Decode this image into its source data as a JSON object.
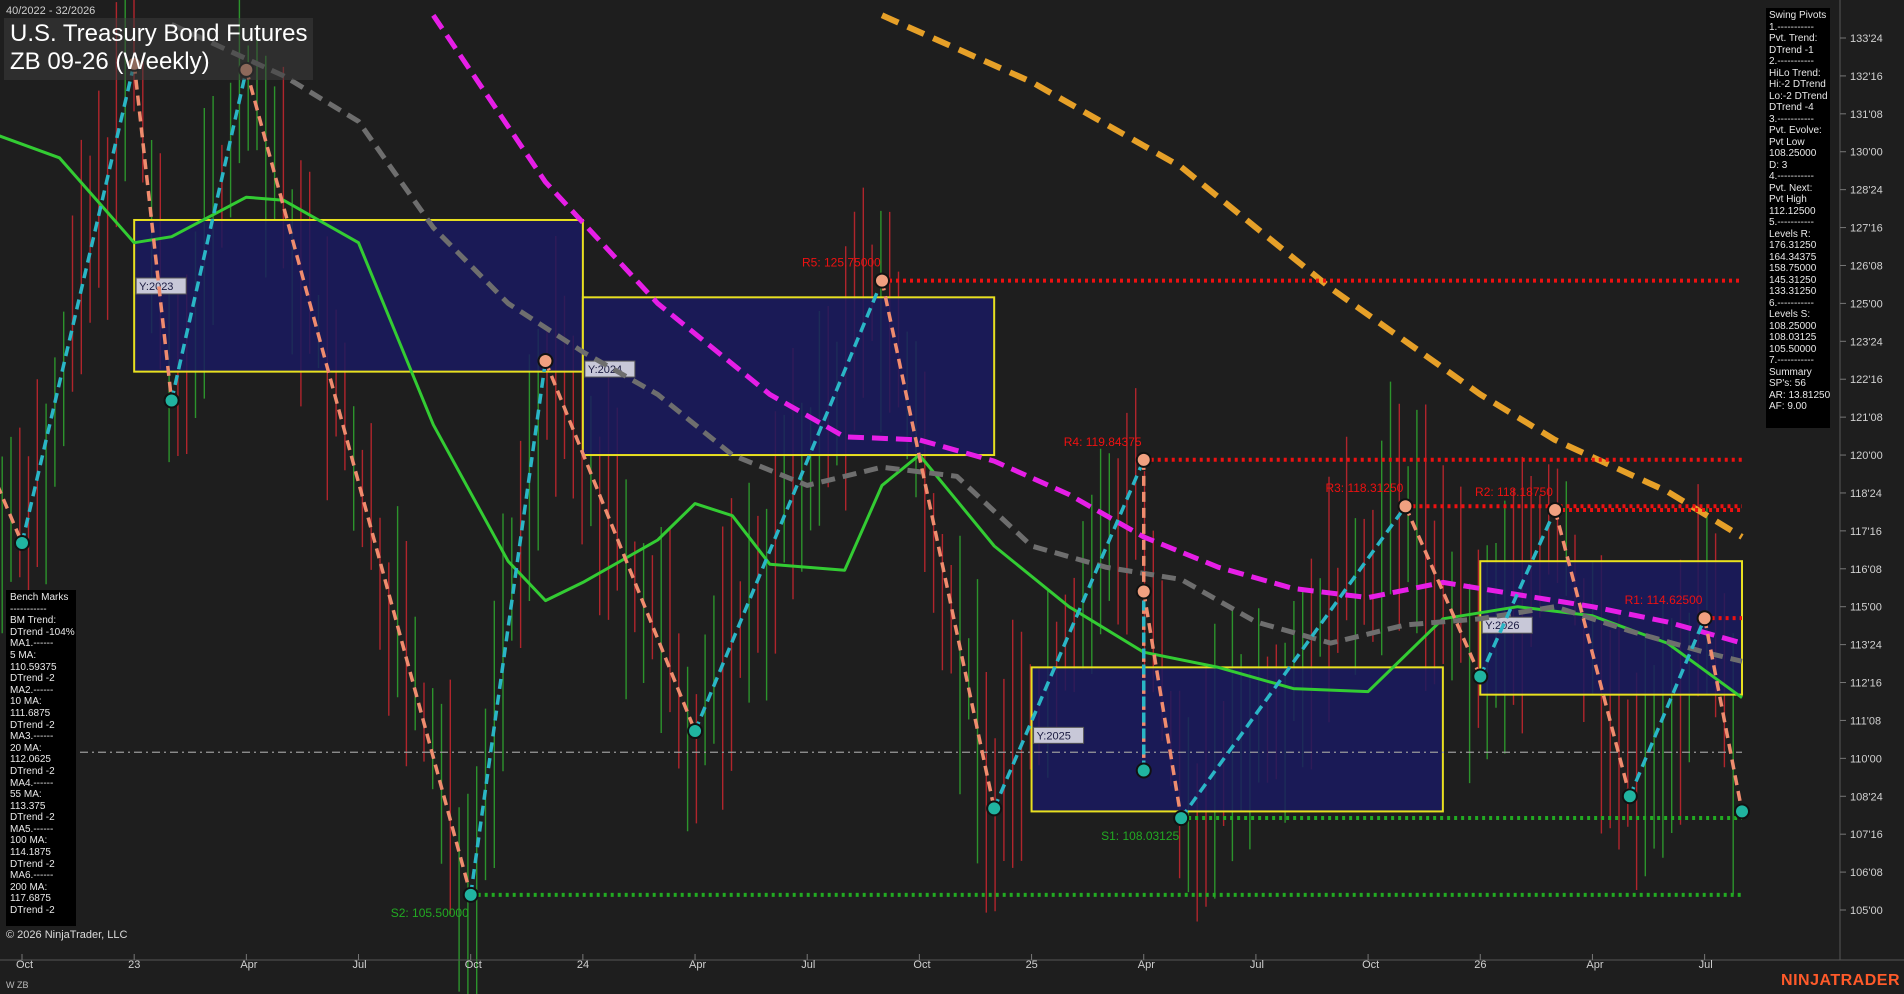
{
  "header": {
    "date_range": "40/2022 - 32/2026",
    "title_line1": "U.S. Treasury Bond Futures",
    "title_line2": "ZB 09-26 (Weekly)"
  },
  "footer": {
    "copyright": "© 2026 NinjaTrader, LLC",
    "brand": "NINJATRADER",
    "symbol_tag": "W ZB"
  },
  "colors": {
    "background": "#1e1e1e",
    "up_bar": "#2ea02e",
    "down_bar": "#c0262e",
    "ma_green": "#33cc33",
    "ma_gray": "#6e6e6e",
    "ma_magenta": "#e61ee6",
    "ma_orange": "#e6a028",
    "swing_up": "#2ab6c6",
    "swing_down": "#f08c6e",
    "zone_fill": "#1a1a60",
    "zone_border": "#e8e020",
    "resistance": "#ee1111",
    "support": "#22aa22"
  },
  "benchmarks": {
    "lines": [
      "Bench Marks",
      "-----------",
      "BM Trend:",
      "DTrend -104%",
      "MA1.------",
      "5 MA:",
      "110.59375",
      "DTrend -2",
      "MA2.------",
      "10 MA:",
      "111.6875",
      "DTrend -2",
      "MA3.------",
      "20 MA:",
      "112.0625",
      "DTrend -2",
      "MA4.------",
      "55 MA:",
      "113.375",
      "DTrend -2",
      "MA5.------",
      "100 MA:",
      "114.1875",
      "DTrend -2",
      "MA6.------",
      "200 MA:",
      "117.6875",
      "DTrend -2"
    ]
  },
  "swing_pivots": {
    "lines": [
      "Swing Pivots",
      "1.-----------",
      "Pvt. Trend:",
      "DTrend -1",
      "2.-----------",
      "HiLo Trend:",
      "Hi:-2 DTrend",
      "Lo:-2 DTrend",
      "DTrend -4",
      "3.-----------",
      "Pvt. Evolve:",
      "Pvt Low",
      "108.25000",
      "D: 3",
      "4.-----------",
      "Pvt. Next:",
      "Pvt High",
      "112.12500",
      "5.-----------",
      "Levels R:",
      "176.31250",
      "164.34375",
      "158.75000",
      "145.31250",
      "133.31250",
      "6.-----------",
      "Levels S:",
      "108.25000",
      "108.03125",
      "105.50000",
      "7.-----------",
      "Summary",
      "SP's: 56",
      "AR: 13.81250",
      "AF: 9.00"
    ]
  },
  "chart_data": {
    "type": "line",
    "title": "U.S. Treasury Bond Futures",
    "subtitle": "ZB 09-26 (Weekly)",
    "x_range": [
      "2022-10",
      "2026-08"
    ],
    "y_range": [
      104.0,
      134.0
    ],
    "y_ticks": [
      "133'24",
      "132'16",
      "131'08",
      "130'00",
      "128'24",
      "127'16",
      "126'08",
      "125'00",
      "123'24",
      "122'16",
      "121'08",
      "120'00",
      "118'24",
      "117'16",
      "116'08",
      "115'00",
      "113'24",
      "112'16",
      "111'08",
      "110'00",
      "108'24",
      "107'16",
      "106'08",
      "105'00"
    ],
    "x_ticks": [
      "Oct",
      "23",
      "Apr",
      "Jul",
      "Oct",
      "24",
      "Apr",
      "Jul",
      "Oct",
      "25",
      "Apr",
      "Jul",
      "Oct",
      "26",
      "Apr",
      "Jul"
    ],
    "grid": false,
    "current_price_level": 110.2,
    "year_zones": [
      {
        "label": "Y:2023",
        "x_start": "2023-01",
        "x_end": "2024-01",
        "high": 127.75,
        "low": 122.75
      },
      {
        "label": "Y:2024",
        "x_start": "2024-01",
        "x_end": "2024-12",
        "high": 125.2,
        "low": 120.0
      },
      {
        "label": "Y:2025",
        "x_start": "2025-01",
        "x_end": "2025-12",
        "high": 113.0,
        "low": 108.25
      },
      {
        "label": "Y:2026",
        "x_start": "2026-01",
        "x_end": "2026-08",
        "high": 116.5,
        "low": 112.1
      }
    ],
    "levels": [
      {
        "label": "R5: 125.75000",
        "value": 125.75,
        "kind": "resistance",
        "x_start": "2024-09"
      },
      {
        "label": "R4: 119.84375",
        "value": 119.84375,
        "kind": "resistance",
        "x_start": "2025-04"
      },
      {
        "label": "R3: 118.31250",
        "value": 118.3125,
        "kind": "resistance",
        "x_start": "2025-11"
      },
      {
        "label": "R2: 118.18750",
        "value": 118.1875,
        "kind": "resistance",
        "x_start": "2026-03"
      },
      {
        "label": "R1: 114.62500",
        "value": 114.625,
        "kind": "resistance",
        "x_start": "2026-07"
      },
      {
        "label": "S1: 108.03125",
        "value": 108.03125,
        "kind": "support",
        "x_start": "2025-05"
      },
      {
        "label": "S2: 105.50000",
        "value": 105.5,
        "kind": "support",
        "x_start": "2023-10"
      }
    ],
    "swing_pivots": [
      {
        "date": "2022-09",
        "price": 120.0
      },
      {
        "date": "2022-10",
        "price": 117.1
      },
      {
        "date": "2023-01",
        "price": 132.9
      },
      {
        "date": "2023-02",
        "price": 121.8
      },
      {
        "date": "2023-04",
        "price": 132.7
      },
      {
        "date": "2023-10",
        "price": 105.5
      },
      {
        "date": "2023-12",
        "price": 123.1
      },
      {
        "date": "2024-04",
        "price": 110.9
      },
      {
        "date": "2024-09",
        "price": 125.75
      },
      {
        "date": "2024-12",
        "price": 108.35
      },
      {
        "date": "2025-04",
        "price": 119.84
      },
      {
        "date": "2025-04",
        "price": 109.6
      },
      {
        "date": "2025-04",
        "price": 115.5
      },
      {
        "date": "2025-05",
        "price": 108.03
      },
      {
        "date": "2025-11",
        "price": 118.31
      },
      {
        "date": "2026-01",
        "price": 112.7
      },
      {
        "date": "2026-03",
        "price": 118.19
      },
      {
        "date": "2026-05",
        "price": 108.75
      },
      {
        "date": "2026-07",
        "price": 114.62
      },
      {
        "date": "2026-08",
        "price": 108.25
      }
    ],
    "series": [
      {
        "kind": "moving-average-green",
        "points": [
          [
            "2022-09",
            130.7
          ],
          [
            "2022-11",
            129.8
          ],
          [
            "2023-01",
            127.0
          ],
          [
            "2023-02",
            127.2
          ],
          [
            "2023-04",
            128.5
          ],
          [
            "2023-05",
            128.4
          ],
          [
            "2023-07",
            127.0
          ],
          [
            "2023-09",
            121.0
          ],
          [
            "2023-11",
            116.5
          ],
          [
            "2023-12",
            115.2
          ],
          [
            "2024-01",
            115.8
          ],
          [
            "2024-03",
            117.2
          ],
          [
            "2024-04",
            118.4
          ],
          [
            "2024-05",
            118.0
          ],
          [
            "2024-06",
            116.4
          ],
          [
            "2024-08",
            116.2
          ],
          [
            "2024-09",
            119.0
          ],
          [
            "2024-10",
            120.0
          ],
          [
            "2024-12",
            117.0
          ],
          [
            "2025-02",
            115.0
          ],
          [
            "2025-04",
            113.5
          ],
          [
            "2025-06",
            113.0
          ],
          [
            "2025-08",
            112.3
          ],
          [
            "2025-10",
            112.2
          ],
          [
            "2025-12",
            114.6
          ],
          [
            "2026-02",
            115.0
          ],
          [
            "2026-04",
            114.7
          ],
          [
            "2026-06",
            113.8
          ],
          [
            "2026-08",
            112.0
          ]
        ]
      },
      {
        "kind": "moving-average-gray",
        "points": [
          [
            "2023-02",
            134.2
          ],
          [
            "2023-05",
            132.5
          ],
          [
            "2023-07",
            131.0
          ],
          [
            "2023-09",
            127.5
          ],
          [
            "2023-11",
            125.0
          ],
          [
            "2024-01",
            123.4
          ],
          [
            "2024-03",
            122.0
          ],
          [
            "2024-05",
            120.0
          ],
          [
            "2024-07",
            119.0
          ],
          [
            "2024-09",
            119.6
          ],
          [
            "2024-11",
            119.3
          ],
          [
            "2025-01",
            117.0
          ],
          [
            "2025-03",
            116.3
          ],
          [
            "2025-05",
            115.9
          ],
          [
            "2025-07",
            114.5
          ],
          [
            "2025-09",
            113.8
          ],
          [
            "2025-11",
            114.4
          ],
          [
            "2026-01",
            114.6
          ],
          [
            "2026-03",
            115.0
          ],
          [
            "2026-05",
            114.2
          ],
          [
            "2026-07",
            113.5
          ],
          [
            "2026-08",
            113.2
          ]
        ]
      },
      {
        "kind": "moving-average-magenta",
        "points": [
          [
            "2023-09",
            134.5
          ],
          [
            "2023-12",
            129.0
          ],
          [
            "2024-03",
            125.0
          ],
          [
            "2024-06",
            122.0
          ],
          [
            "2024-08",
            120.6
          ],
          [
            "2024-10",
            120.5
          ],
          [
            "2024-12",
            119.8
          ],
          [
            "2025-02",
            118.7
          ],
          [
            "2025-04",
            117.3
          ],
          [
            "2025-06",
            116.3
          ],
          [
            "2025-08",
            115.6
          ],
          [
            "2025-10",
            115.3
          ],
          [
            "2025-12",
            115.8
          ],
          [
            "2026-02",
            115.4
          ],
          [
            "2026-04",
            115.0
          ],
          [
            "2026-06",
            114.5
          ],
          [
            "2026-08",
            113.8
          ]
        ]
      },
      {
        "kind": "moving-average-orange",
        "points": [
          [
            "2024-09",
            134.5
          ],
          [
            "2025-01",
            132.3
          ],
          [
            "2025-05",
            129.5
          ],
          [
            "2025-09",
            125.5
          ],
          [
            "2026-01",
            122.0
          ],
          [
            "2026-03",
            120.5
          ],
          [
            "2026-06",
            118.8
          ],
          [
            "2026-08",
            117.3
          ]
        ]
      }
    ]
  }
}
